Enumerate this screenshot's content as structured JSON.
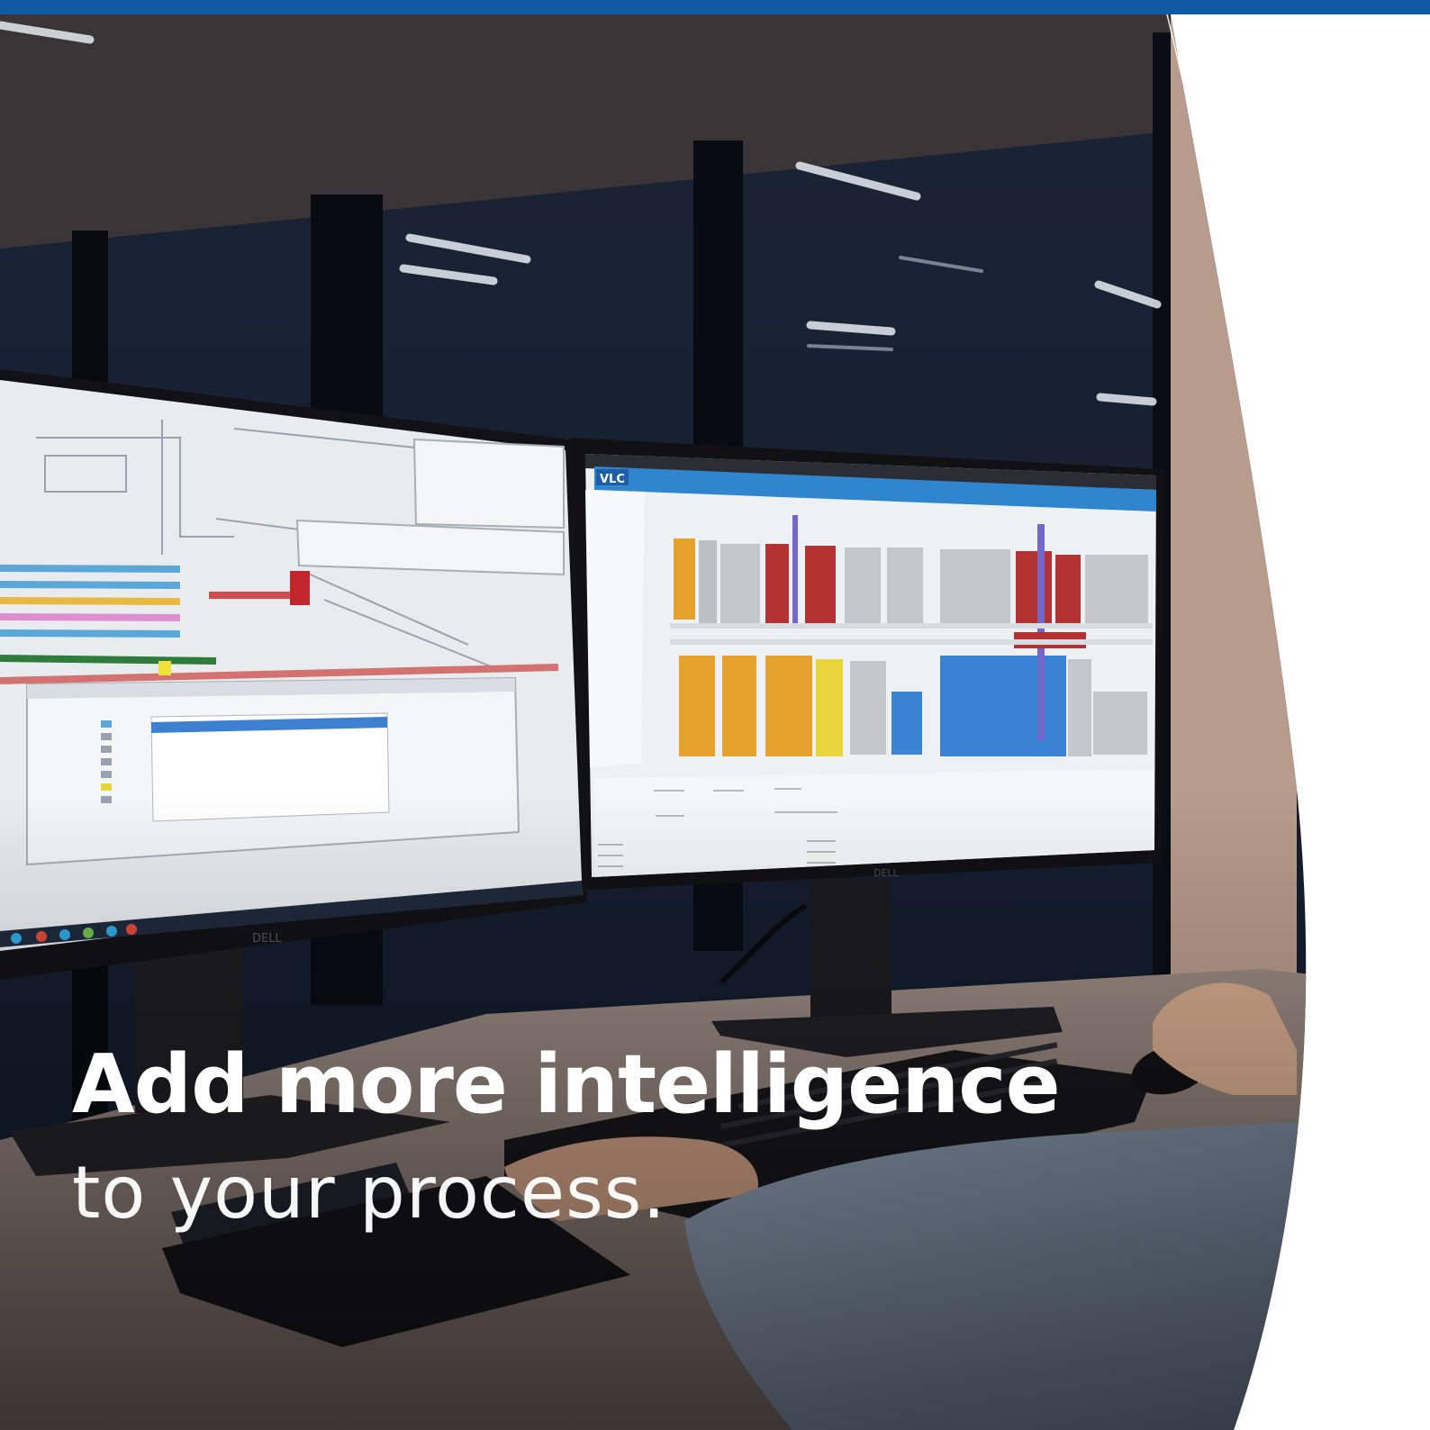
{
  "headline": "Add more intelligence",
  "subheadline": "to your process.",
  "colors": {
    "top_bar": "#0f5aa5",
    "text": "#ffffff",
    "right_panel": "#ffffff"
  },
  "monitor_logos": [
    "DELL",
    "DELL"
  ],
  "screen_logo": "VLC"
}
